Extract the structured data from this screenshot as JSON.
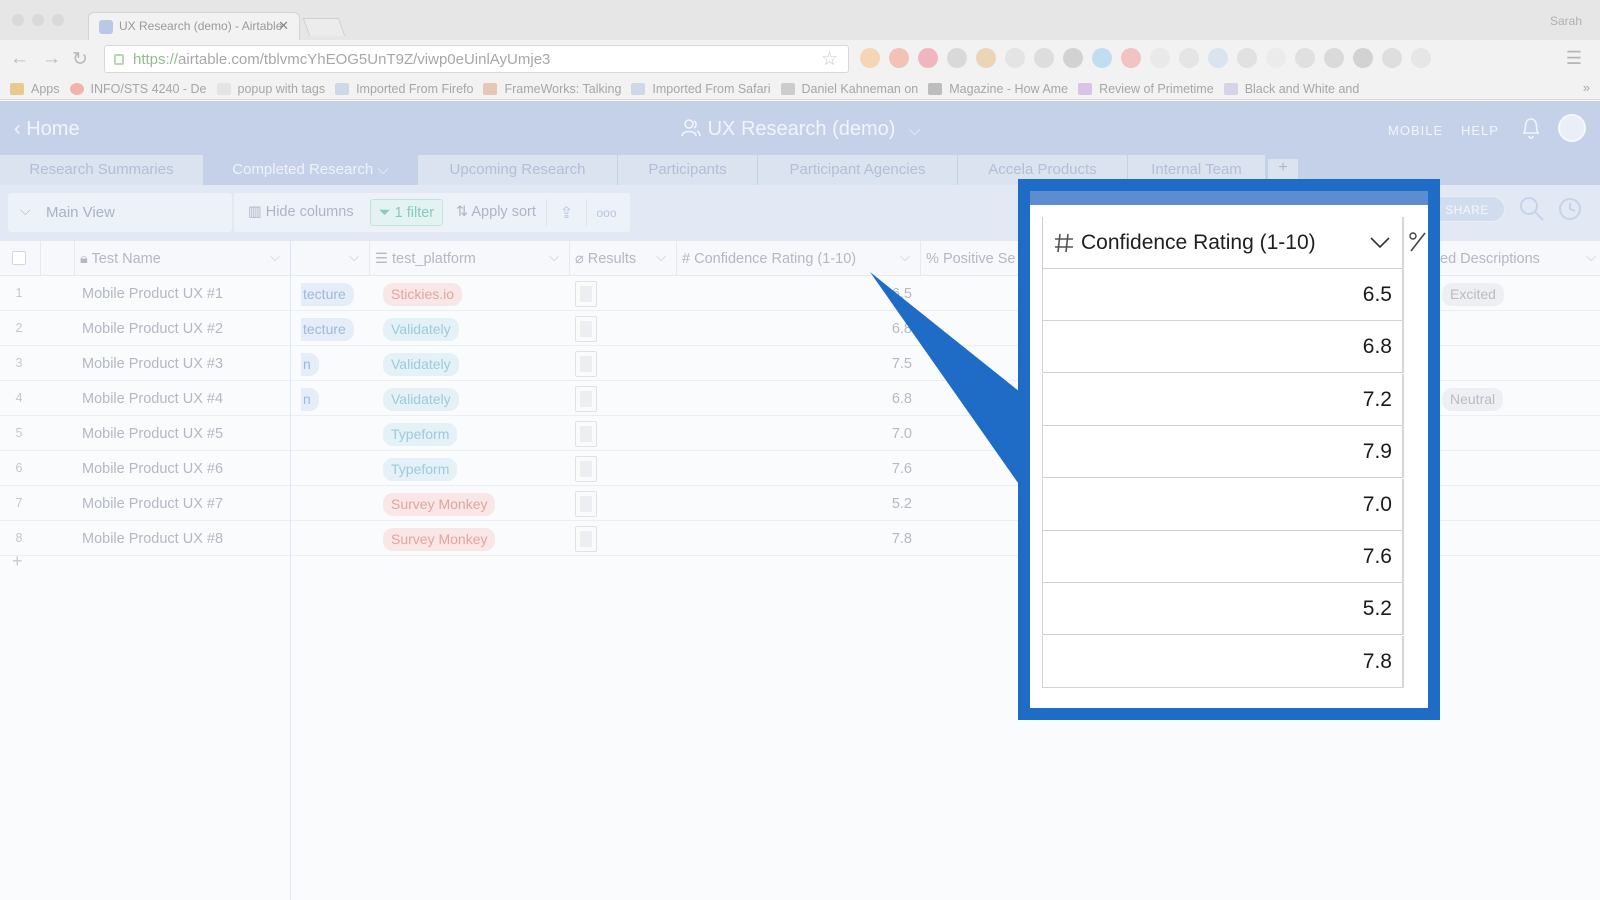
{
  "browser": {
    "tab_title": "UX Research (demo) - Airtable",
    "user": "Sarah",
    "url_scheme": "https://",
    "url_rest": "airtable.com/tblvmcYhEOG5UnT9Z/viwp0eUinlAyUmje3",
    "bookmarks": [
      {
        "label": "Apps"
      },
      {
        "label": "INFO/STS 4240 - De"
      },
      {
        "label": "popup with tags"
      },
      {
        "label": "Imported From Firefo"
      },
      {
        "label": "FrameWorks: Talking"
      },
      {
        "label": "Imported From Safari"
      },
      {
        "label": "Daniel Kahneman on"
      },
      {
        "label": "Magazine - How Ame"
      },
      {
        "label": "Review of Primetime"
      },
      {
        "label": "Black and White and"
      }
    ],
    "bookmarks_more": "»"
  },
  "app": {
    "home_label": "Home",
    "base_title": "UX Research (demo)",
    "mobile_label": "MOBILE",
    "help_label": "HELP",
    "tables": [
      "Research Summaries",
      "Completed Research",
      "Upcoming Research",
      "Participants",
      "Participant Agencies",
      "Accela Products",
      "Internal Team"
    ],
    "add_table": "+"
  },
  "viewbar": {
    "view_name": "Main View",
    "hide_columns": "Hide columns",
    "filter": "1 filter",
    "apply_sort": "Apply sort",
    "more": "ooo",
    "share": "SHARE"
  },
  "grid": {
    "headers": {
      "test_name": "Test Name",
      "test_platform": "test_platform",
      "results": "Results",
      "confidence": "Confidence Rating (1-10)",
      "positive": "Positive Se",
      "descriptions": "ed Descriptions"
    },
    "rows": [
      {
        "num": "1",
        "name": "Mobile Product UX #1",
        "method": "tecture",
        "platform": "Stickies.io",
        "platform_color": "pink",
        "rating": "6.5",
        "desc": "Excited"
      },
      {
        "num": "2",
        "name": "Mobile Product UX #2",
        "method": "tecture",
        "platform": "Validately",
        "platform_color": "teal",
        "rating": "6.8",
        "desc": ""
      },
      {
        "num": "3",
        "name": "Mobile Product UX #3",
        "method": "n",
        "platform": "Validately",
        "platform_color": "teal",
        "rating": "7.5",
        "desc": ""
      },
      {
        "num": "4",
        "name": "Mobile Product UX #4",
        "method": "n",
        "platform": "Validately",
        "platform_color": "teal",
        "rating": "6.8",
        "desc": "Neutral"
      },
      {
        "num": "5",
        "name": "Mobile Product UX #5",
        "method": "",
        "platform": "Typeform",
        "platform_color": "teal",
        "rating": "7.0",
        "desc": ""
      },
      {
        "num": "6",
        "name": "Mobile Product UX #6",
        "method": "",
        "platform": "Typeform",
        "platform_color": "teal",
        "rating": "7.6",
        "desc": ""
      },
      {
        "num": "7",
        "name": "Mobile Product UX #7",
        "method": "",
        "platform": "Survey Monkey",
        "platform_color": "pink",
        "rating": "5.2",
        "desc": ""
      },
      {
        "num": "8",
        "name": "Mobile Product UX #8",
        "method": "",
        "platform": "Survey Monkey",
        "platform_color": "pink",
        "rating": "7.8",
        "desc": ""
      }
    ],
    "add_row": "+"
  },
  "callout": {
    "header": "Confidence Rating (1-10)",
    "values": [
      "6.5",
      "6.8",
      "7.2",
      "7.9",
      "7.0",
      "7.6",
      "5.2",
      "7.8"
    ],
    "frame_color": "#1e6cc6"
  }
}
